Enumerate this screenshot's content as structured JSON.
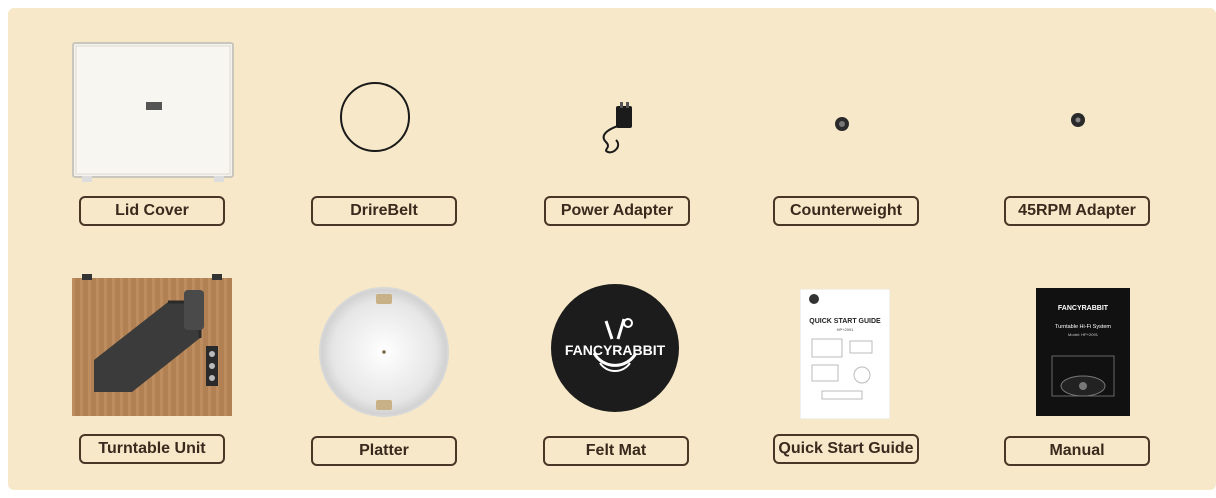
{
  "items_row1": [
    {
      "label": "Lid Cover",
      "icon": "lid-cover-image"
    },
    {
      "label": "DrireBelt",
      "icon": "drive-belt-image"
    },
    {
      "label": "Power Adapter",
      "icon": "power-adapter-image"
    },
    {
      "label": "Counterweight",
      "icon": "counterweight-image"
    },
    {
      "label": "45RPM Adapter",
      "icon": "45rpm-adapter-image"
    }
  ],
  "items_row2": [
    {
      "label": "Turntable Unit",
      "icon": "turntable-unit-image"
    },
    {
      "label": "Platter",
      "icon": "platter-image"
    },
    {
      "label": "Felt Mat",
      "icon": "felt-mat-image",
      "logo_text": "FANCYRABBIT"
    },
    {
      "label": "Quick Start Guide",
      "icon": "quick-start-guide-image",
      "doc_title": "QUICK START GUIDE",
      "doc_model": "HP+2091"
    },
    {
      "label": "Manual",
      "icon": "manual-image",
      "doc_brand": "FANCYRABBIT",
      "doc_title": "Turntable Hi-Fi System",
      "doc_model": "Model: HP+2091"
    }
  ],
  "colors": {
    "background": "#f6e8c8",
    "label_border": "#4a3626",
    "label_text": "#3a2a1e"
  }
}
